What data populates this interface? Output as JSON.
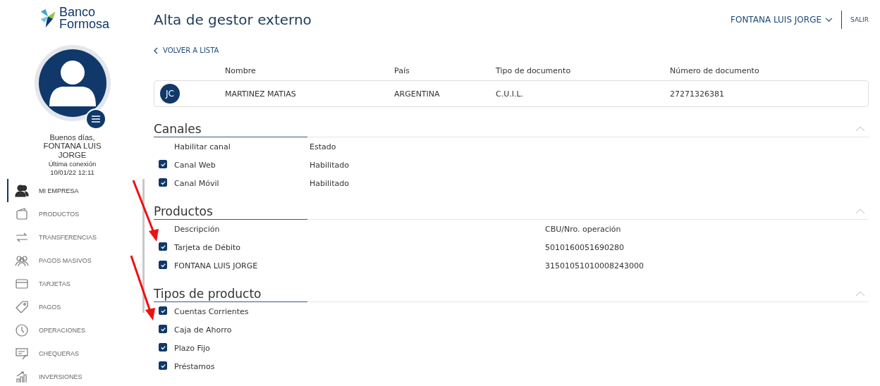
{
  "sidebar": {
    "logo": {
      "line1": "Banco",
      "line2": "Formosa"
    },
    "greeting": "Buenos días,",
    "user_name": "FONTANA LUIS JORGE",
    "last_login_label": "Última conexión",
    "last_login": "10/01/22 12:11",
    "nav": [
      {
        "label": "MI EMPRESA",
        "selected": true
      },
      {
        "label": "PRODUCTOS",
        "selected": false
      },
      {
        "label": "TRANSFERENCIAS",
        "selected": false
      },
      {
        "label": "PAGOS MASIVOS",
        "selected": false
      },
      {
        "label": "TARJETAS",
        "selected": false
      },
      {
        "label": "PAGOS",
        "selected": false
      },
      {
        "label": "OPERACIONES",
        "selected": false
      },
      {
        "label": "CHEQUERAS",
        "selected": false
      },
      {
        "label": "INVERSIONES",
        "selected": false
      }
    ]
  },
  "header": {
    "title": "Alta de gestor externo",
    "user_menu": "FONTANA LUIS JORGE",
    "logout": "SALIR"
  },
  "back_link": "VOLVER A LISTA",
  "person": {
    "columns": [
      "Nombre",
      "País",
      "Tipo de documento",
      "Número de documento"
    ],
    "initials": "JC",
    "values": [
      "MARTINEZ MATIAS",
      "ARGENTINA",
      "C.U.I.L.",
      "27271326381"
    ]
  },
  "sections": [
    {
      "kind": "channels",
      "title": "Canales",
      "expanded": true,
      "columns": [
        "Habilitar canal",
        "Estado"
      ],
      "rows": [
        {
          "label": "Canal Web",
          "checked": true,
          "value": "Habilitado"
        },
        {
          "label": "Canal Móvil",
          "checked": true,
          "value": "Habilitado"
        }
      ]
    },
    {
      "kind": "products",
      "title": "Productos",
      "expanded": true,
      "columns": [
        "Descripción",
        "CBU/Nro. operación"
      ],
      "rows": [
        {
          "label": "Tarjeta de Débito",
          "checked": true,
          "value": "5010160051690280"
        },
        {
          "label": "FONTANA LUIS JORGE",
          "checked": true,
          "value": "31501051010008243000"
        }
      ]
    },
    {
      "kind": "types",
      "title": "Tipos de producto",
      "expanded": true,
      "rows": [
        {
          "label": "Cuentas Corrientes",
          "checked": true
        },
        {
          "label": "Caja de Ahorro",
          "checked": true
        },
        {
          "label": "Plazo Fijo",
          "checked": true
        },
        {
          "label": "Préstamos",
          "checked": true
        }
      ]
    }
  ]
}
